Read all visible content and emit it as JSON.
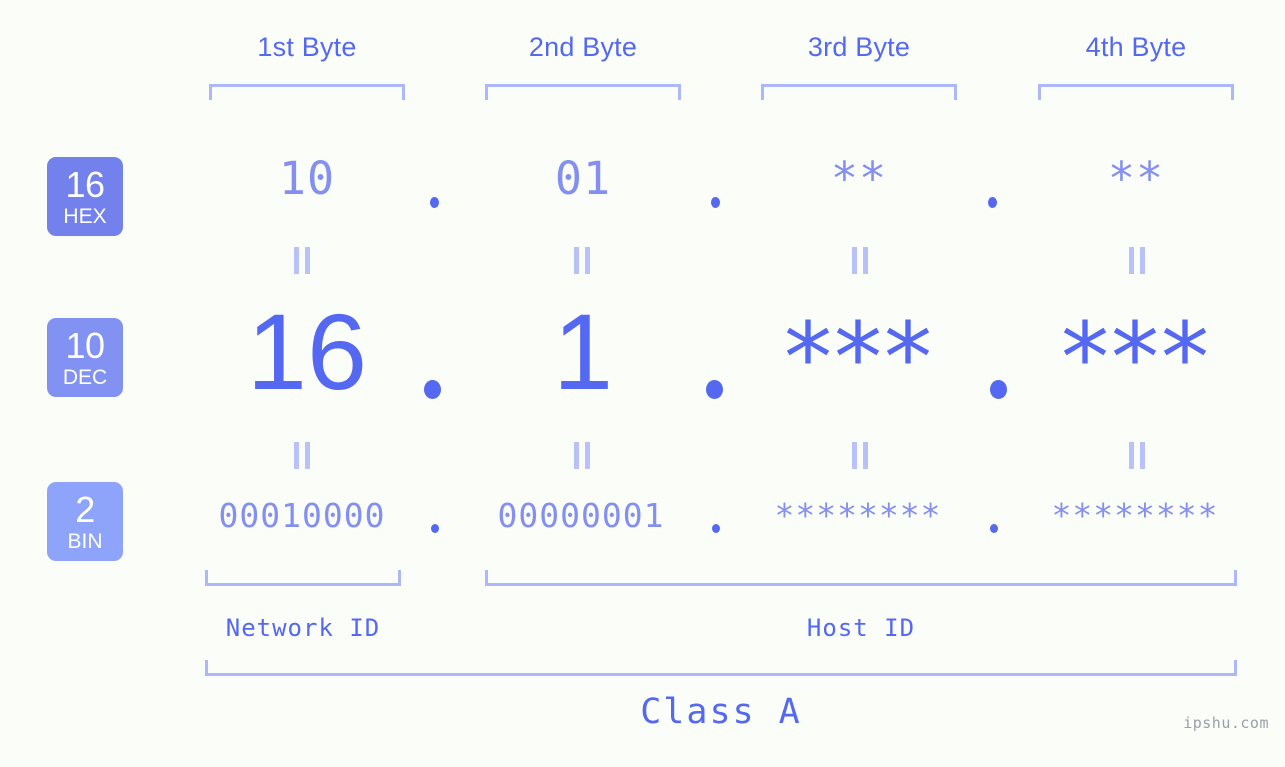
{
  "background_color": "#fbfdf8",
  "accent_color": "#5468f2",
  "accent_light_color": "#8390f2",
  "bracket_color": "#acb8fa",
  "byte_headers": [
    {
      "label": "1st Byte"
    },
    {
      "label": "2nd Byte"
    },
    {
      "label": "3rd Byte"
    },
    {
      "label": "4th Byte"
    }
  ],
  "bases": [
    {
      "number": "16",
      "name": "HEX",
      "color": "#7381ec"
    },
    {
      "number": "10",
      "name": "DEC",
      "color": "#8292f2"
    },
    {
      "number": "2",
      "name": "BIN",
      "color": "#8da4fa"
    }
  ],
  "rows": {
    "hex": {
      "base_number": "16",
      "base_name": "HEX",
      "values": [
        "10",
        "01",
        "**",
        "**"
      ],
      "separators": [
        ".",
        ".",
        "."
      ]
    },
    "dec": {
      "base_number": "10",
      "base_name": "DEC",
      "values": [
        "16",
        "1",
        "***",
        "***"
      ],
      "separators": [
        ".",
        ".",
        "."
      ]
    },
    "bin": {
      "base_number": "2",
      "base_name": "BIN",
      "values": [
        "00010000",
        "00000001",
        "********",
        "********"
      ],
      "separators": [
        ".",
        ".",
        "."
      ]
    }
  },
  "equality_marks": {
    "glyph": "=",
    "count_per_row": 4,
    "rows": 2
  },
  "segments": {
    "network_id": "Network ID",
    "host_id": "Host ID"
  },
  "class_label": "Class A",
  "watermark": "ipshu.com"
}
